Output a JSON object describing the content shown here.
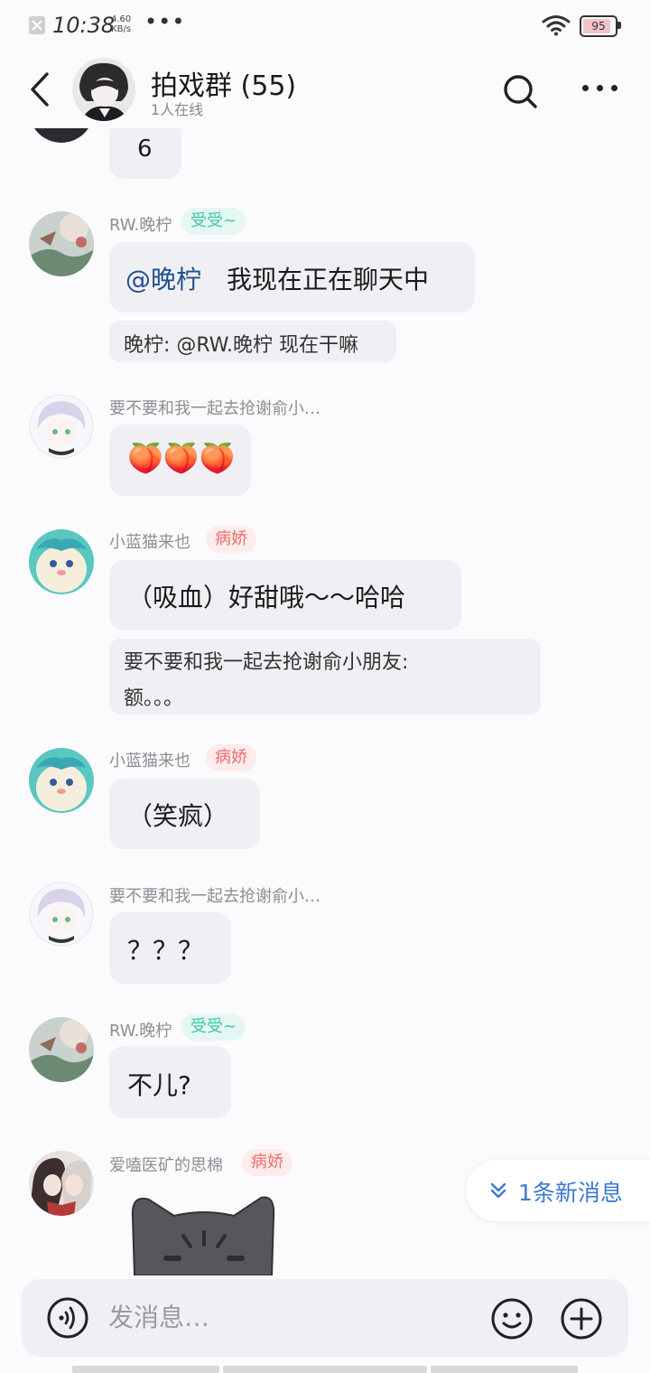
{
  "status_bar": {
    "time": "10:38",
    "speed_value": "4.60",
    "speed_unit": "KB/s",
    "more": "•••",
    "battery": "95"
  },
  "header": {
    "title": "拍戏群 (55)",
    "subtitle": "1人在线"
  },
  "top_message": {
    "text": "6"
  },
  "messages": [
    {
      "sender": "RW.晚柠",
      "badge": "受受~",
      "mention": "@晚柠",
      "text": "我现在正在聊天中",
      "quote": "晚柠: @RW.晚柠 现在干嘛"
    },
    {
      "sender": "要不要和我一起去抢谢俞小…",
      "text": "🍑🍑🍑"
    },
    {
      "sender": "小蓝猫来也",
      "badge": "病娇",
      "text": "（吸血）好甜哦～～哈哈",
      "quote_line1": "要不要和我一起去抢谢俞小朋友:",
      "quote_line2": "额。。。"
    },
    {
      "sender": "小蓝猫来也",
      "badge": "病娇",
      "text": "（笑疯）"
    },
    {
      "sender": "要不要和我一起去抢谢俞小…",
      "text": "？？？"
    },
    {
      "sender": "RW.晚柠",
      "badge": "受受~",
      "text": "不儿?"
    },
    {
      "sender": "爱嗑医矿的思棉",
      "badge": "病娇"
    }
  ],
  "new_message_pill": {
    "label": "1条新消息"
  },
  "input": {
    "placeholder": "发消息…"
  },
  "colors": {
    "teal_badge": "#3fc6a9",
    "red_badge": "#ef6a6a",
    "link_blue": "#3c78cf",
    "mention": "#1f4f8f"
  }
}
